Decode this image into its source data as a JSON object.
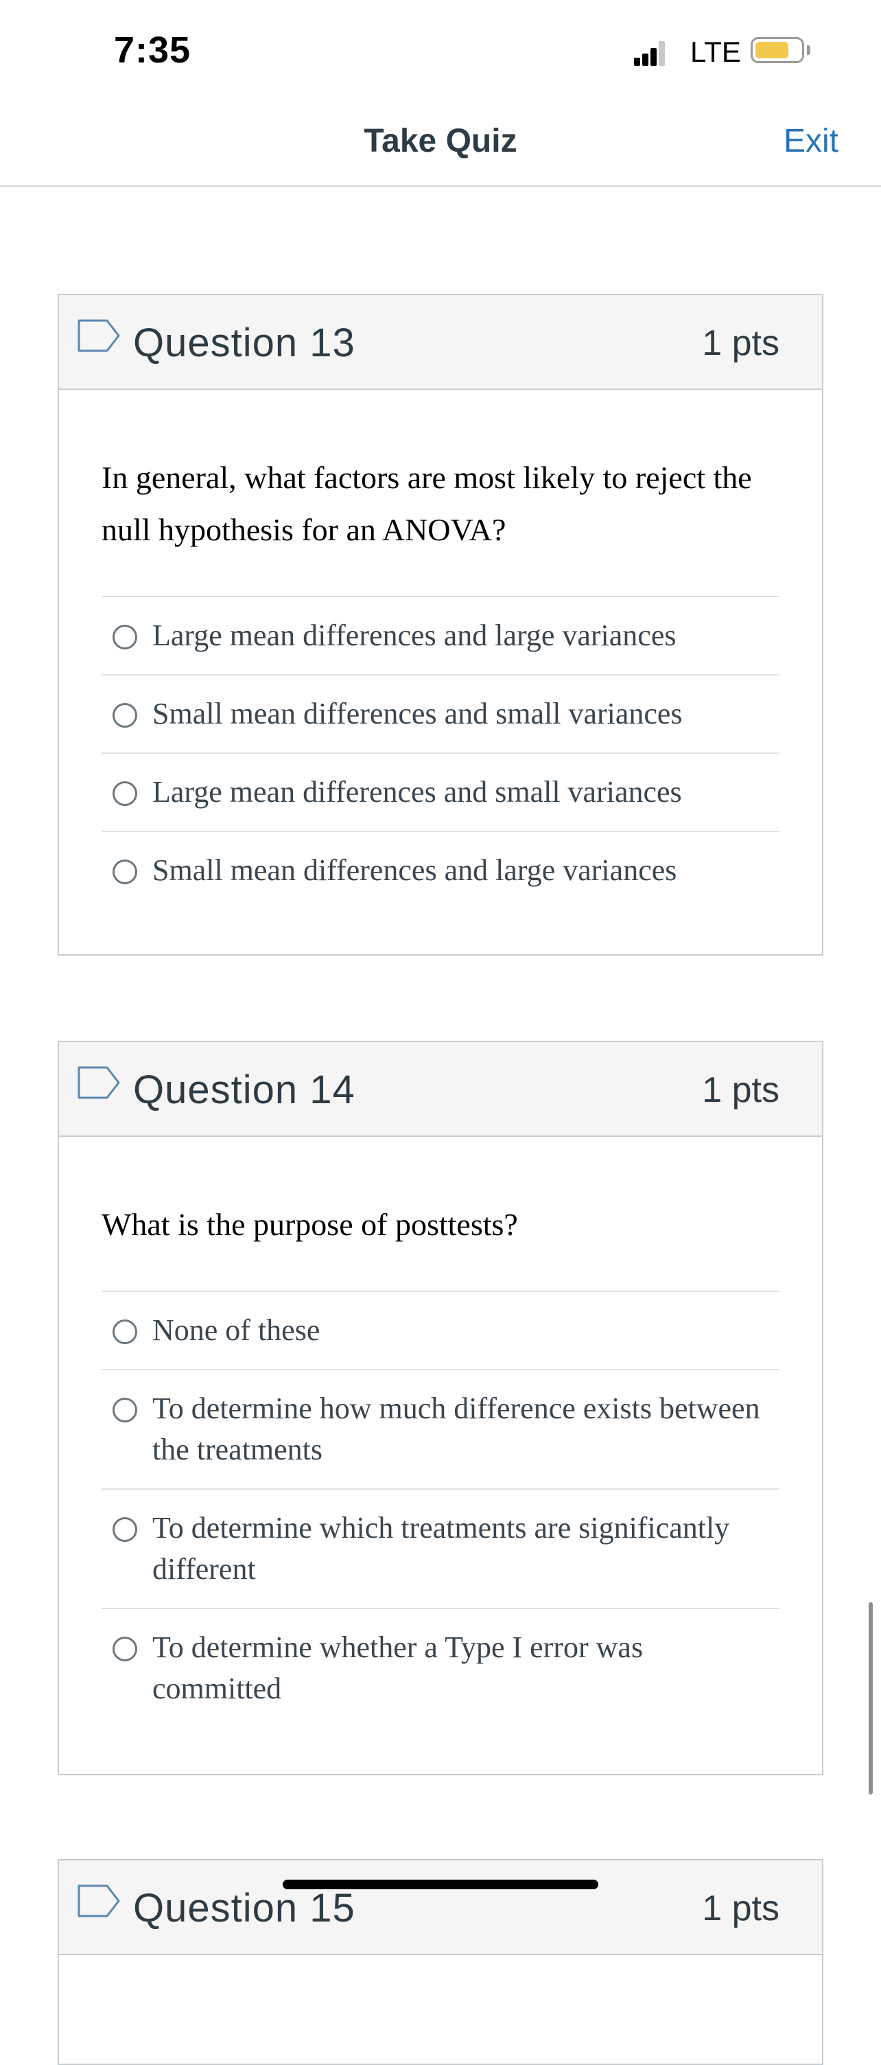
{
  "status": {
    "time": "7:35",
    "network": "LTE",
    "battery_level": 0.75,
    "battery_color": "#f2c94c"
  },
  "nav": {
    "title": "Take Quiz",
    "exit_label": "Exit"
  },
  "questions": [
    {
      "title": "Question 13",
      "points": "1 pts",
      "text": "In general, what factors are most likely to reject the null hypothesis for an ANOVA?",
      "answers": [
        "Large mean differences and large variances",
        "Small mean differences and small variances",
        "Large mean differences and small variances",
        "Small mean differences and large variances"
      ]
    },
    {
      "title": "Question 14",
      "points": "1 pts",
      "text": "What is the purpose of posttests?",
      "answers": [
        "None of these",
        "To determine how much difference exists between the treatments",
        "To determine which treatments are significantly different",
        "To determine whether a Type I error was committed"
      ]
    },
    {
      "title": "Question 15",
      "points": "1 pts"
    }
  ],
  "colors": {
    "accent": "#2a73b8",
    "text": "#2d3b45",
    "header_bg": "#f5f5f5",
    "border": "#c7cdd1"
  },
  "icons": {
    "flag": "flag-outline-icon",
    "radio": "radio-empty-icon"
  }
}
